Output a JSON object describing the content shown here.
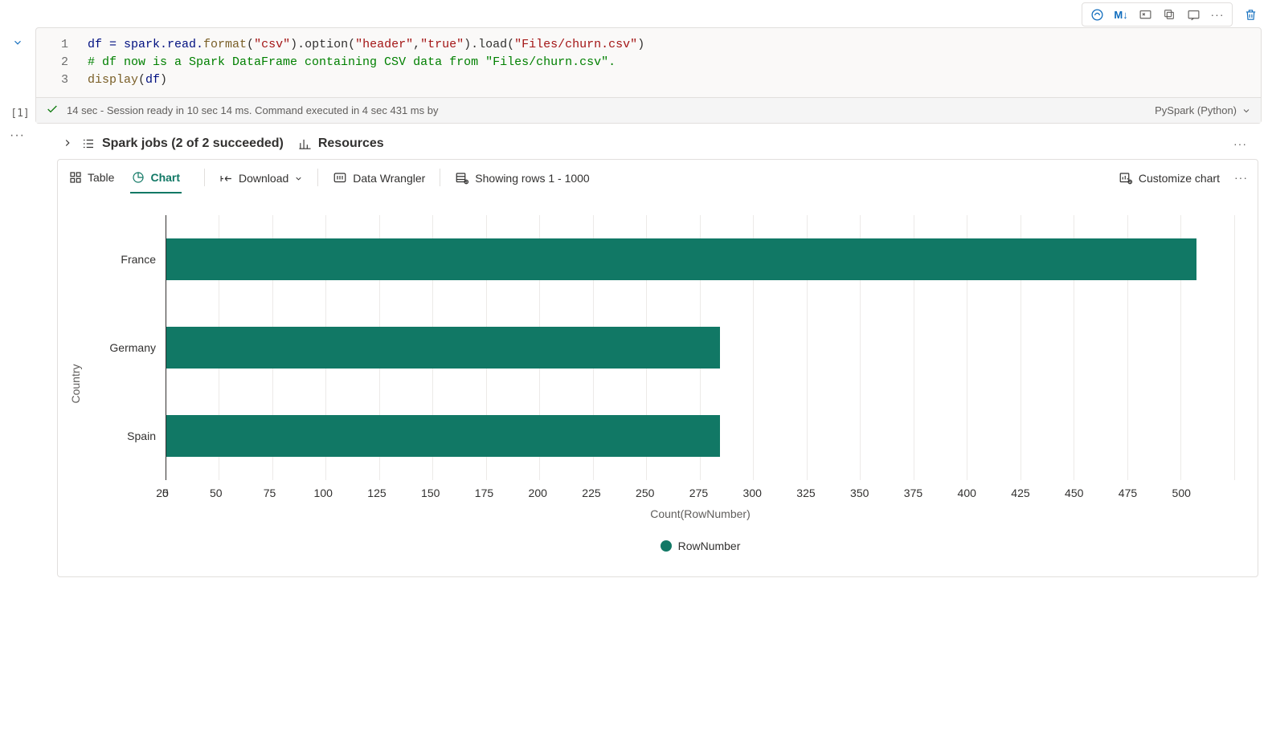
{
  "toolbar_top": {
    "markdown": "M↓"
  },
  "code": {
    "lines": [
      "1",
      "2",
      "3"
    ],
    "line1_pre": "df = spark.read.",
    "line1_format": "format",
    "line1_csv": "\"csv\"",
    "line1_option": ").option(",
    "line1_header": "\"header\"",
    "line1_comma": ",",
    "line1_true": "\"true\"",
    "line1_load": ").load(",
    "line1_path": "\"Files/churn.csv\"",
    "line1_end": ")",
    "line2": "# df now is a Spark DataFrame containing CSV data from \"Files/churn.csv\".",
    "line3_display": "display",
    "line3_open": "(",
    "line3_df": "df",
    "line3_close": ")"
  },
  "exec": {
    "index": "[1]",
    "status": "14 sec - Session ready in 10 sec 14 ms. Command executed in 4 sec 431 ms by",
    "lang": "PySpark (Python)"
  },
  "sections": {
    "spark_jobs": "Spark jobs (2 of 2 succeeded)",
    "resources": "Resources"
  },
  "output_toolbar": {
    "table": "Table",
    "chart": "Chart",
    "download": "Download",
    "data_wrangler": "Data Wrangler",
    "rows": "Showing rows 1 - 1000",
    "customize": "Customize chart"
  },
  "chart_data": {
    "type": "bar",
    "orientation": "horizontal",
    "categories": [
      "France",
      "Germany",
      "Spain"
    ],
    "values": [
      482,
      259,
      259
    ],
    "xlabel": "Count(RowNumber)",
    "ylabel": "Country",
    "xlim": [
      0,
      500
    ],
    "xticks": [
      0,
      25,
      50,
      75,
      100,
      125,
      150,
      175,
      200,
      225,
      250,
      275,
      300,
      325,
      350,
      375,
      400,
      425,
      450,
      475,
      500
    ],
    "legend": "RowNumber"
  }
}
